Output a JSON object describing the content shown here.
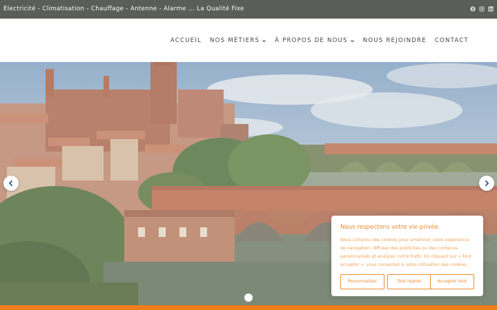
{
  "topbar": {
    "tagline": "Electricité - Climatisation - Chauffage - Antenne - Alarme ... La Qualité Fixe",
    "social_icons": [
      "facebook-icon",
      "instagram-icon",
      "linkedin-icon"
    ]
  },
  "nav": {
    "items": [
      {
        "label": "ACCUEIL",
        "has_dropdown": false
      },
      {
        "label": "NOS MÉTIERS",
        "has_dropdown": true
      },
      {
        "label": "À PROPOS DE NOUS",
        "has_dropdown": true
      },
      {
        "label": "NOUS REJOINDRE",
        "has_dropdown": false
      },
      {
        "label": "CONTACT",
        "has_dropdown": false
      }
    ]
  },
  "slider": {
    "prev_icon": "chevron-left-icon",
    "next_icon": "chevron-right-icon",
    "pagination_dots": 1,
    "active_dot": 1
  },
  "cookie_banner": {
    "title": "Nous respectons votre vie privée.",
    "message": "Nous utilisons des cookies pour améliorer votre expérience de navigation, diffuser des publicités ou des contenus personnalisés et analyser notre trafic. En cliquant sur « Tout accepter », vous consentez à notre utilisation des cookies.",
    "buttons": {
      "customize": "Personnaliser",
      "reject": "Tout rejeter",
      "accept": "Accepter tout"
    }
  },
  "colors": {
    "topbar_bg": "#5a5e5a",
    "accent": "#ee7d1c",
    "cookie_accent": "#f08a2a",
    "nav_text": "#444444"
  }
}
